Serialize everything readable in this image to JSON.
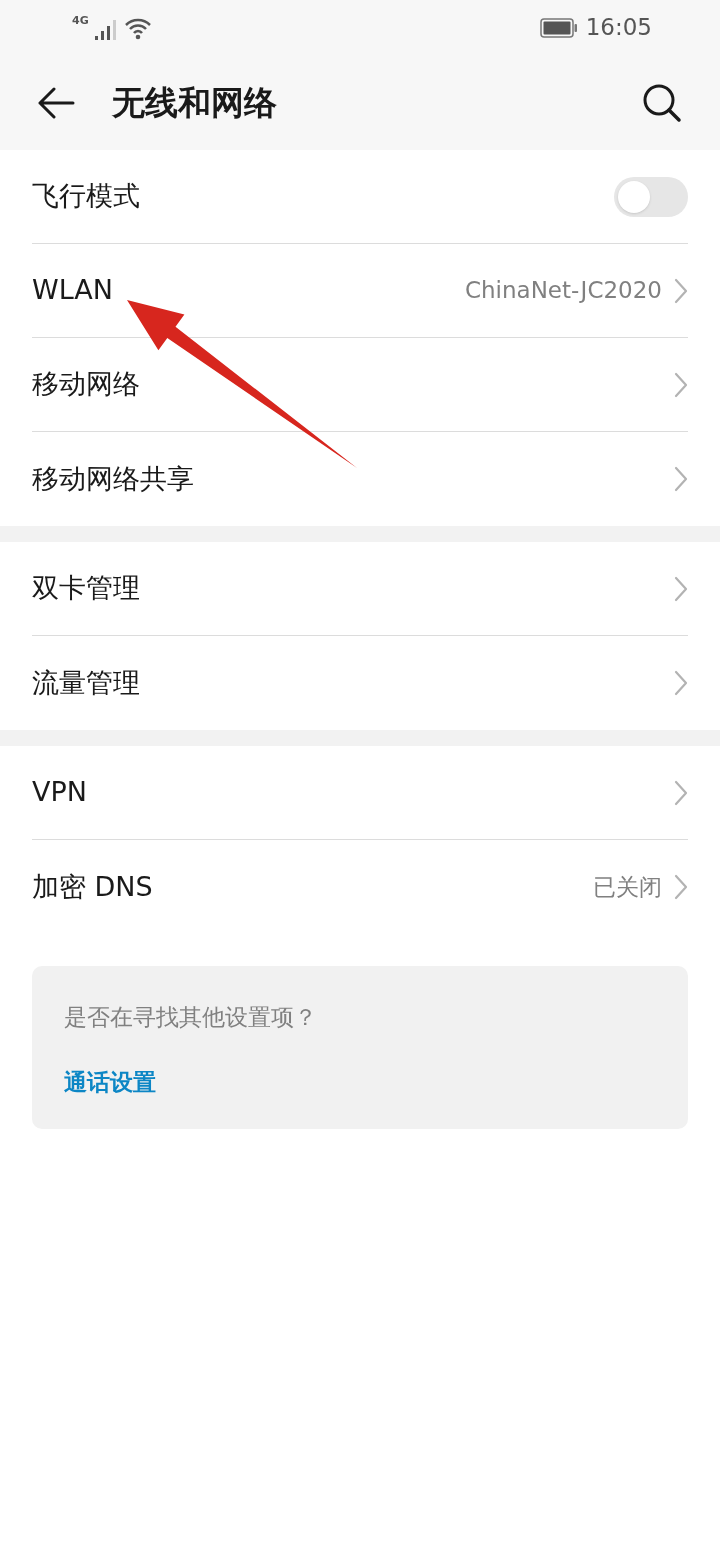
{
  "status_bar": {
    "network": "4G",
    "time": "16:05"
  },
  "header": {
    "title": "无线和网络"
  },
  "sections": [
    {
      "items": [
        {
          "kind": "switch",
          "label": "飞行模式",
          "on": false
        },
        {
          "kind": "link",
          "label": "WLAN",
          "value": "ChinaNet-JC2020"
        },
        {
          "kind": "link",
          "label": "移动网络"
        },
        {
          "kind": "link",
          "label": "移动网络共享"
        }
      ]
    },
    {
      "items": [
        {
          "kind": "link",
          "label": "双卡管理"
        },
        {
          "kind": "link",
          "label": "流量管理"
        }
      ]
    },
    {
      "items": [
        {
          "kind": "link",
          "label": "VPN"
        },
        {
          "kind": "link",
          "label": "加密 DNS",
          "value": "已关闭"
        }
      ]
    }
  ],
  "suggestion_card": {
    "prompt": "是否在寻找其他设置项？",
    "links": [
      "通话设置"
    ]
  }
}
